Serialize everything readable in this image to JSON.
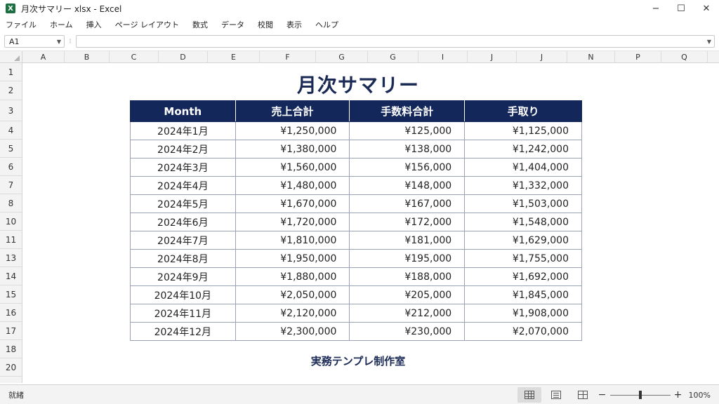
{
  "window": {
    "title": "月次サマリー xlsx - Excel",
    "app_icon_letter": "X",
    "controls": {
      "minimize": "−",
      "maximize": "☐",
      "close": "✕"
    }
  },
  "menu": [
    "ファイル",
    "ホーム",
    "挿入",
    "ページ レイアウト",
    "数式",
    "データ",
    "校閲",
    "表示",
    "ヘルプ"
  ],
  "formula_bar": {
    "name_box": "A1",
    "separator": "⁝",
    "formula": ""
  },
  "columns": [
    "A",
    "B",
    "C",
    "D",
    "E",
    "F",
    "G",
    "G",
    "I",
    "J",
    "J",
    "N",
    "P",
    "Q"
  ],
  "rows": [
    "1",
    "2",
    "3",
    "4",
    "5",
    "6",
    "7",
    "8",
    "10",
    "11",
    "13",
    "14",
    "15",
    "16",
    "17",
    "18",
    "20"
  ],
  "sheet": {
    "title": "月次サマリー",
    "headers": [
      "Month",
      "売上合計",
      "手数料合計",
      "手取り"
    ],
    "data": [
      [
        "2024年1月",
        "¥1,250,000",
        "¥125,000",
        "¥1,125,000"
      ],
      [
        "2024年2月",
        "¥1,380,000",
        "¥138,000",
        "¥1,242,000"
      ],
      [
        "2024年3月",
        "¥1,560,000",
        "¥156,000",
        "¥1,404,000"
      ],
      [
        "2024年4月",
        "¥1,480,000",
        "¥148,000",
        "¥1,332,000"
      ],
      [
        "2024年5月",
        "¥1,670,000",
        "¥167,000",
        "¥1,503,000"
      ],
      [
        "2024年6月",
        "¥1,720,000",
        "¥172,000",
        "¥1,548,000"
      ],
      [
        "2024年7月",
        "¥1,810,000",
        "¥181,000",
        "¥1,629,000"
      ],
      [
        "2024年8月",
        "¥1,950,000",
        "¥195,000",
        "¥1,755,000"
      ],
      [
        "2024年9月",
        "¥1,880,000",
        "¥188,000",
        "¥1,692,000"
      ],
      [
        "2024年10月",
        "¥2,050,000",
        "¥205,000",
        "¥1,845,000"
      ],
      [
        "2024年11月",
        "¥2,120,000",
        "¥212,000",
        "¥1,908,000"
      ],
      [
        "2024年12月",
        "¥2,300,000",
        "¥230,000",
        "¥2,070,000"
      ]
    ],
    "footer": "実務テンプレ制作室"
  },
  "status_bar": {
    "status": "就緒",
    "zoom_minus": "−",
    "zoom_plus": "+",
    "zoom_level": "100%",
    "zoom_fraction": 0.5
  },
  "colors": {
    "header_bg": "#13275a",
    "title_color": "#1a2a55",
    "excel_green": "#1d6f42"
  }
}
